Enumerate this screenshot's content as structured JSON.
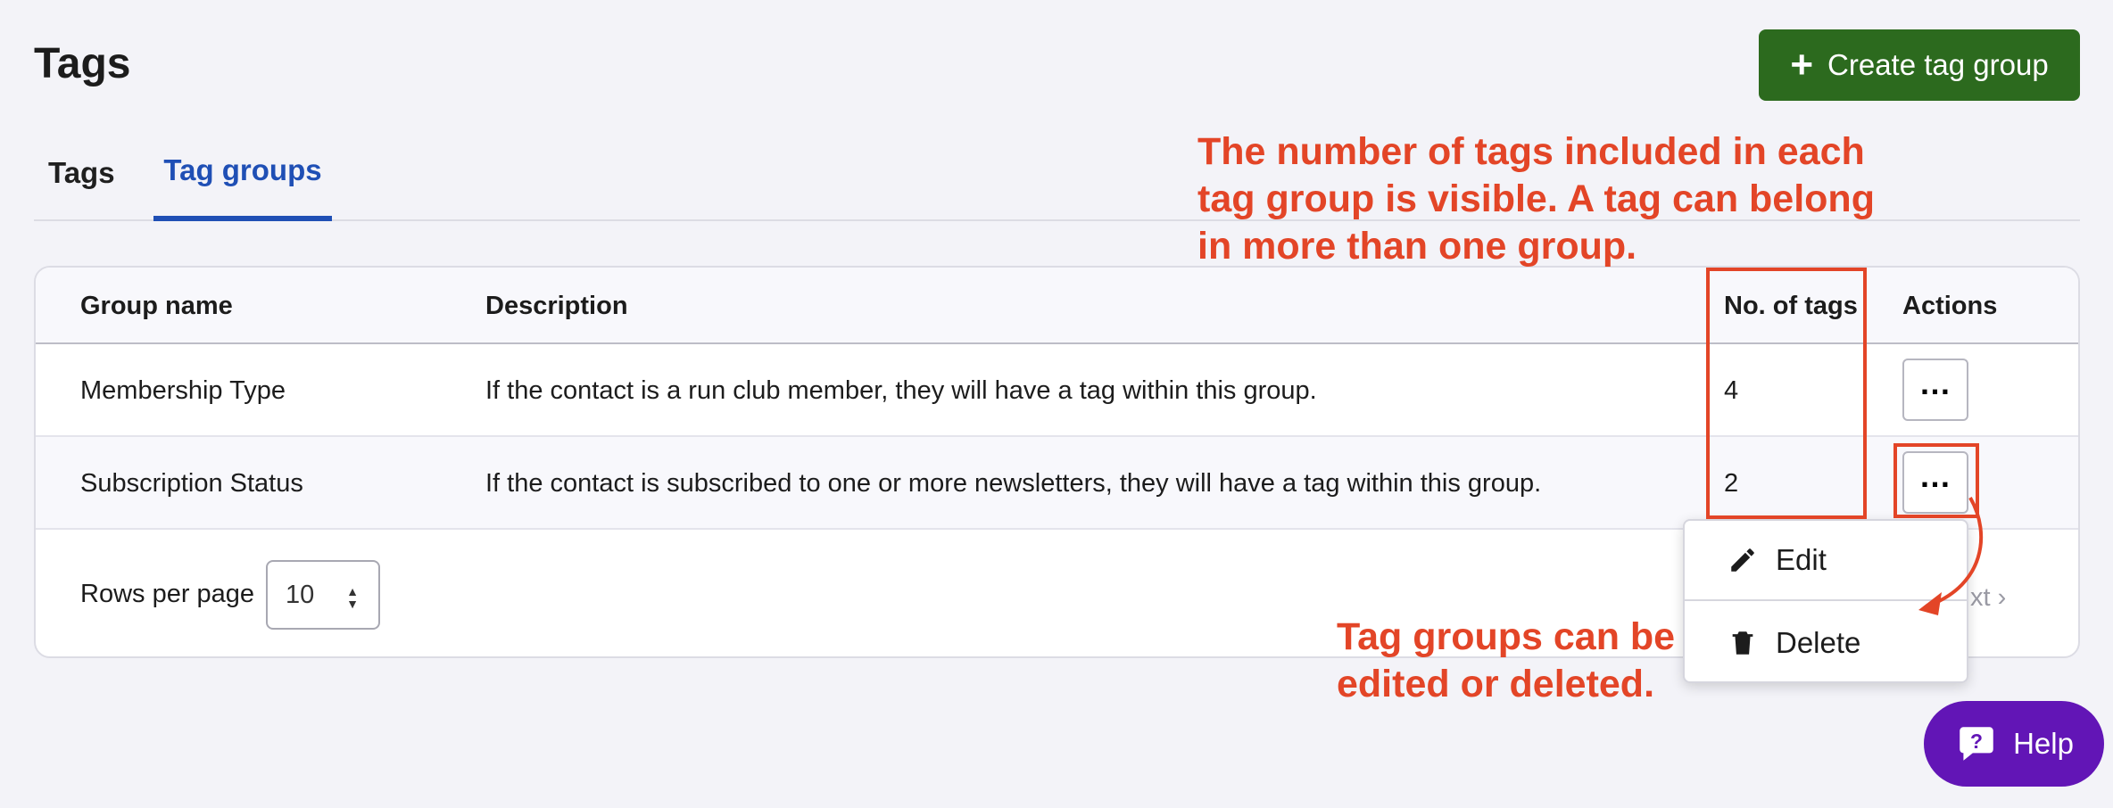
{
  "page": {
    "title": "Tags"
  },
  "header": {
    "create_button_label": "Create tag group"
  },
  "tabs": [
    {
      "label": "Tags",
      "active": false
    },
    {
      "label": "Tag groups",
      "active": true
    }
  ],
  "table": {
    "columns": [
      "Group name",
      "Description",
      "No. of tags",
      "Actions"
    ],
    "rows": [
      {
        "name": "Membership Type",
        "description": "If the contact is a run club member, they will have a tag within this group.",
        "count": "4"
      },
      {
        "name": "Subscription Status",
        "description": "If the contact is subscribed to one or more newsletters, they will have a tag within this group.",
        "count": "2"
      }
    ],
    "actions_icon": "more-horizontal-icon"
  },
  "pagination": {
    "rows_per_page_label": "Rows per page",
    "rows_per_page_value": "10",
    "next_label_visible": "xt"
  },
  "action_menu": {
    "items": [
      {
        "label": "Edit",
        "icon": "pencil-icon"
      },
      {
        "label": "Delete",
        "icon": "trash-icon"
      }
    ]
  },
  "annotations": {
    "count_note": "The number of tags included in each tag group is visible. A tag can belong in more than one group.",
    "actions_note": "Tag groups can be edited or deleted."
  },
  "help": {
    "label": "Help"
  },
  "colors": {
    "primary_button": "#2c6a1e",
    "active_tab": "#1f4fb5",
    "annotation": "#e34527",
    "help_button": "#6215b6"
  }
}
